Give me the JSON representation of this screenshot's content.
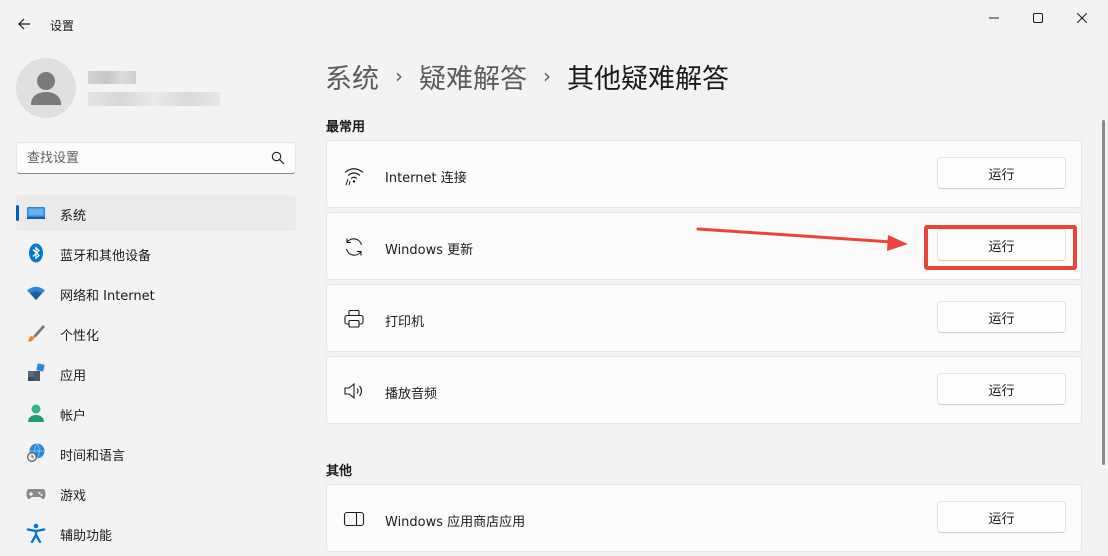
{
  "window": {
    "title": "设置",
    "controls": {
      "minimize_icon": "minimize-icon",
      "maximize_icon": "maximize-icon",
      "close_icon": "close-icon"
    },
    "back_icon": "back-arrow-icon"
  },
  "search": {
    "placeholder": "查找设置",
    "value": "",
    "icon": "search-icon"
  },
  "sidebar": {
    "items": [
      {
        "label": "系统",
        "icon": "system-display-icon",
        "active": true
      },
      {
        "label": "蓝牙和其他设备",
        "icon": "bluetooth-icon",
        "active": false
      },
      {
        "label": "网络和 Internet",
        "icon": "wifi-icon",
        "active": false
      },
      {
        "label": "个性化",
        "icon": "paintbrush-icon",
        "active": false
      },
      {
        "label": "应用",
        "icon": "apps-icon",
        "active": false
      },
      {
        "label": "帐户",
        "icon": "account-icon",
        "active": false
      },
      {
        "label": "时间和语言",
        "icon": "time-language-icon",
        "active": false
      },
      {
        "label": "游戏",
        "icon": "gamepad-icon",
        "active": false
      },
      {
        "label": "辅助功能",
        "icon": "accessibility-icon",
        "active": false
      }
    ]
  },
  "breadcrumb": {
    "items": [
      "系统",
      "疑难解答"
    ],
    "current": "其他疑难解答",
    "separator": "›"
  },
  "sections": {
    "common": {
      "title": "最常用",
      "items": [
        {
          "label": "Internet 连接",
          "icon": "internet-connection-icon",
          "button": "运行"
        },
        {
          "label": "Windows 更新",
          "icon": "windows-update-icon",
          "button": "运行"
        },
        {
          "label": "打印机",
          "icon": "printer-icon",
          "button": "运行"
        },
        {
          "label": "播放音频",
          "icon": "speaker-icon",
          "button": "运行"
        }
      ]
    },
    "other": {
      "title": "其他",
      "items": [
        {
          "label": "Windows 应用商店应用",
          "icon": "store-app-icon",
          "button": "运行"
        }
      ]
    }
  },
  "colors": {
    "accent": "#005fb8",
    "annotation": "#e8463a",
    "background": "#f3f3f3",
    "card": "#fbfbfb"
  }
}
